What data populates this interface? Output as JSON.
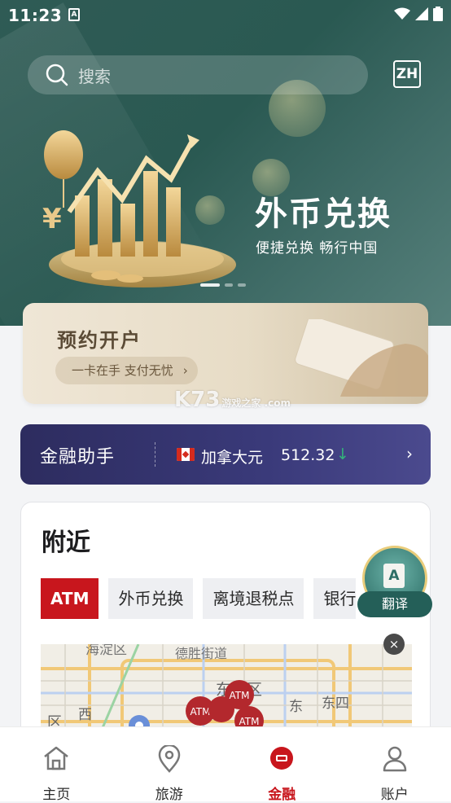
{
  "status_bar": {
    "time": "11:23",
    "app_badge": "A"
  },
  "header": {
    "search_placeholder": "搜索",
    "lang_button": "ZH"
  },
  "hero": {
    "title": "外币兑换",
    "subtitle": "便捷兑换  畅行中国",
    "currency_symbol": "¥"
  },
  "appointment": {
    "title": "预约开户",
    "pill_text": "一卡在手 支付无忧",
    "pill_chevron": "›"
  },
  "watermark": {
    "text": "K73",
    "small": "游戏之家 .com"
  },
  "finance": {
    "title": "金融助手",
    "currency": "加拿大元",
    "rate": "512.32",
    "trend": "↓",
    "chevron": "›"
  },
  "nearby": {
    "title": "附近",
    "chips": [
      "ATM",
      "外币兑换",
      "离境退税点",
      "银行"
    ],
    "map_labels": [
      "海淀区",
      "德胜街道",
      "东城区",
      "东",
      "东四",
      "西",
      "区",
      "ATM",
      "ATM",
      "ATM"
    ],
    "close": "×"
  },
  "translate_fab": {
    "label": "翻译",
    "doc_letter": "A"
  },
  "bottom_nav": [
    {
      "label": "主页",
      "icon": "home-icon"
    },
    {
      "label": "旅游",
      "icon": "location-pin-icon"
    },
    {
      "label": "金融",
      "icon": "finance-icon"
    },
    {
      "label": "账户",
      "icon": "account-icon"
    }
  ],
  "colors": {
    "brand_red": "#c8161d",
    "hero_green": "#2f5b55",
    "finance_navy": "#2d2c5f",
    "trend_green": "#34b27b"
  }
}
